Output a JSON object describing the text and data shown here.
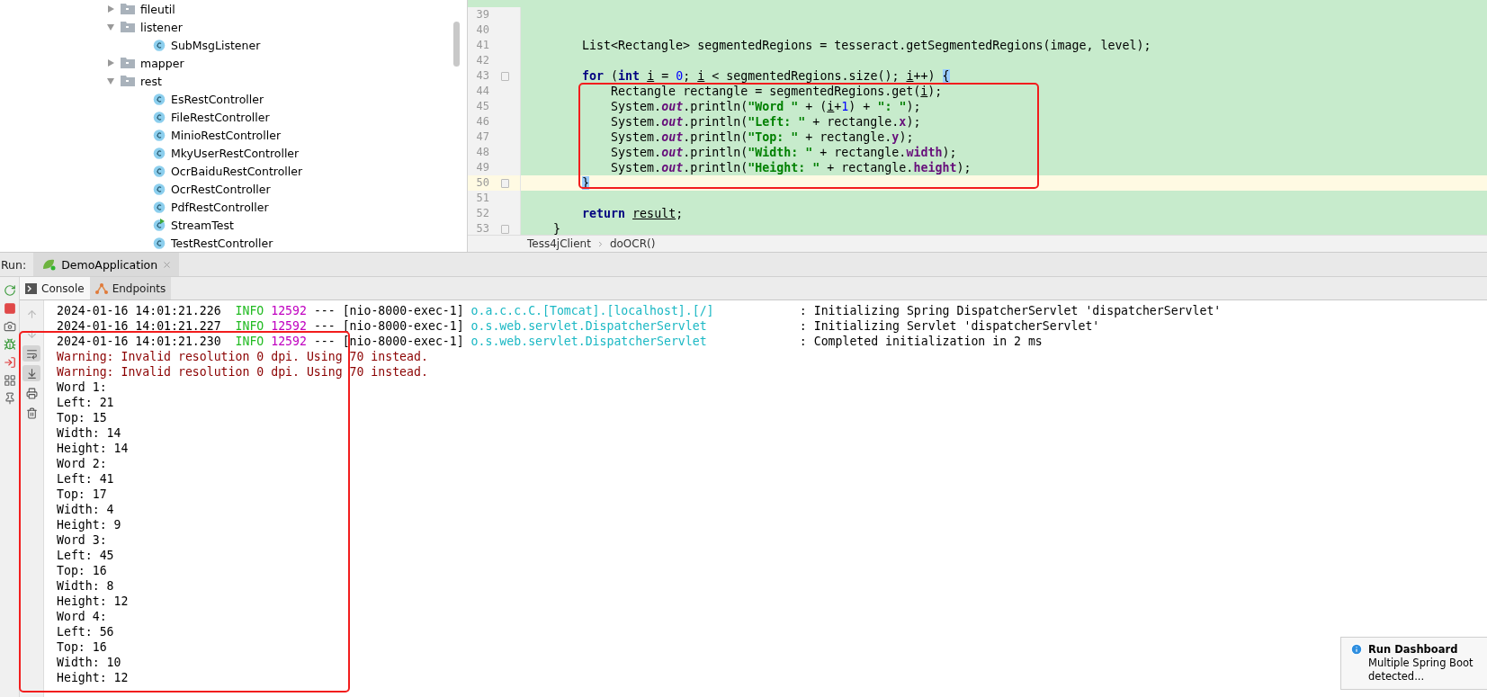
{
  "project_tree": {
    "items": [
      {
        "label": "fileutil",
        "kind": "folder",
        "expanded": false
      },
      {
        "label": "listener",
        "kind": "folder",
        "expanded": true,
        "children": [
          {
            "label": "SubMsgListener",
            "kind": "class"
          }
        ]
      },
      {
        "label": "mapper",
        "kind": "folder",
        "expanded": false
      },
      {
        "label": "rest",
        "kind": "folder",
        "expanded": true,
        "children": [
          {
            "label": "EsRestController",
            "kind": "class"
          },
          {
            "label": "FileRestController",
            "kind": "class"
          },
          {
            "label": "MinioRestController",
            "kind": "class"
          },
          {
            "label": "MkyUserRestController",
            "kind": "class"
          },
          {
            "label": "OcrBaiduRestController",
            "kind": "class"
          },
          {
            "label": "OcrRestController",
            "kind": "class"
          },
          {
            "label": "PdfRestController",
            "kind": "class"
          },
          {
            "label": "StreamTest",
            "kind": "runnable"
          },
          {
            "label": "TestRestController",
            "kind": "class"
          }
        ]
      }
    ]
  },
  "editor": {
    "lines": [
      {
        "number": "39",
        "current": false,
        "fold": false
      },
      {
        "number": "40",
        "current": false,
        "fold": false
      },
      {
        "number": "41",
        "current": false,
        "fold": false,
        "tokens": [
          {
            "kind": "plain",
            "text": "        List<Rectangle> segmentedRegions = tesseract.getSegmentedRegions(image, level);"
          }
        ]
      },
      {
        "number": "42",
        "current": false,
        "fold": false
      },
      {
        "number": "43",
        "current": false,
        "fold": true,
        "tokens": [
          {
            "kind": "kw",
            "text": "        for"
          },
          {
            "kind": "plain",
            "text": " ("
          },
          {
            "kind": "kw",
            "text": "int "
          },
          {
            "kind": "var",
            "text": "i"
          },
          {
            "kind": "plain",
            "text": " = "
          },
          {
            "kind": "num",
            "text": "0"
          },
          {
            "kind": "plain",
            "text": "; "
          },
          {
            "kind": "var",
            "text": "i"
          },
          {
            "kind": "plain",
            "text": " < segmentedRegions.size(); "
          },
          {
            "kind": "var",
            "text": "i"
          },
          {
            "kind": "plain",
            "text": "++) "
          },
          {
            "kind": "match",
            "text": "{"
          }
        ]
      },
      {
        "number": "44",
        "current": false,
        "fold": false,
        "tokens": [
          {
            "kind": "plain",
            "text": "            Rectangle rectangle = segmentedRegions.get("
          },
          {
            "kind": "var",
            "text": "i"
          },
          {
            "kind": "plain",
            "text": ");"
          }
        ]
      },
      {
        "number": "45",
        "current": false,
        "fold": false,
        "tokens": [
          {
            "kind": "plain",
            "text": "            System."
          },
          {
            "kind": "static",
            "text": "out"
          },
          {
            "kind": "plain",
            "text": ".println("
          },
          {
            "kind": "str",
            "text": "\"Word \""
          },
          {
            "kind": "plain",
            "text": " + ("
          },
          {
            "kind": "var",
            "text": "i"
          },
          {
            "kind": "plain",
            "text": "+"
          },
          {
            "kind": "num",
            "text": "1"
          },
          {
            "kind": "plain",
            "text": ") + "
          },
          {
            "kind": "str",
            "text": "\": \""
          },
          {
            "kind": "plain",
            "text": ");"
          }
        ]
      },
      {
        "number": "46",
        "current": false,
        "fold": false,
        "tokens": [
          {
            "kind": "plain",
            "text": "            System."
          },
          {
            "kind": "static",
            "text": "out"
          },
          {
            "kind": "plain",
            "text": ".println("
          },
          {
            "kind": "str",
            "text": "\"Left: \""
          },
          {
            "kind": "plain",
            "text": " + rectangle."
          },
          {
            "kind": "field",
            "text": "x"
          },
          {
            "kind": "plain",
            "text": ");"
          }
        ]
      },
      {
        "number": "47",
        "current": false,
        "fold": false,
        "tokens": [
          {
            "kind": "plain",
            "text": "            System."
          },
          {
            "kind": "static",
            "text": "out"
          },
          {
            "kind": "plain",
            "text": ".println("
          },
          {
            "kind": "str",
            "text": "\"Top: \""
          },
          {
            "kind": "plain",
            "text": " + rectangle."
          },
          {
            "kind": "field",
            "text": "y"
          },
          {
            "kind": "plain",
            "text": ");"
          }
        ]
      },
      {
        "number": "48",
        "current": false,
        "fold": false,
        "tokens": [
          {
            "kind": "plain",
            "text": "            System."
          },
          {
            "kind": "static",
            "text": "out"
          },
          {
            "kind": "plain",
            "text": ".println("
          },
          {
            "kind": "str",
            "text": "\"Width: \""
          },
          {
            "kind": "plain",
            "text": " + rectangle."
          },
          {
            "kind": "field",
            "text": "width"
          },
          {
            "kind": "plain",
            "text": ");"
          }
        ]
      },
      {
        "number": "49",
        "current": false,
        "fold": false,
        "tokens": [
          {
            "kind": "plain",
            "text": "            System."
          },
          {
            "kind": "static",
            "text": "out"
          },
          {
            "kind": "plain",
            "text": ".println("
          },
          {
            "kind": "str",
            "text": "\"Height: \""
          },
          {
            "kind": "plain",
            "text": " + rectangle."
          },
          {
            "kind": "field",
            "text": "height"
          },
          {
            "kind": "plain",
            "text": ");"
          }
        ]
      },
      {
        "number": "50",
        "current": true,
        "fold": true,
        "tokens": [
          {
            "kind": "match",
            "text": "        }"
          }
        ]
      },
      {
        "number": "51",
        "current": false,
        "fold": false
      },
      {
        "number": "52",
        "current": false,
        "fold": false,
        "tokens": [
          {
            "kind": "kw",
            "text": "        return "
          },
          {
            "kind": "var",
            "text": "result"
          },
          {
            "kind": "plain",
            "text": ";"
          }
        ]
      },
      {
        "number": "53",
        "current": false,
        "fold": true,
        "tokens": [
          {
            "kind": "plain",
            "text": "    }"
          }
        ]
      }
    ],
    "breadcrumb": [
      "Tess4jClient",
      "doOCR()"
    ]
  },
  "run_panel": {
    "label": "Run:",
    "tabs": [
      {
        "label": "DemoApplication",
        "selected": true
      }
    ],
    "side_tools": [
      {
        "kind": "rerun"
      },
      {
        "kind": "stop"
      },
      {
        "kind": "camera"
      },
      {
        "kind": "debug"
      },
      {
        "kind": "exit"
      },
      {
        "kind": "layout"
      },
      {
        "kind": "pin"
      }
    ],
    "console_tabs": [
      {
        "label": "Console",
        "kind": "console",
        "selected": true
      },
      {
        "label": "Endpoints",
        "kind": "endpoints",
        "selected": false
      }
    ],
    "console_tools": [
      {
        "kind": "up",
        "on": false,
        "disabled": true
      },
      {
        "kind": "down",
        "on": false,
        "disabled": true
      },
      {
        "kind": "wrap",
        "on": true,
        "disabled": false
      },
      {
        "kind": "scroll_end",
        "on": true,
        "disabled": false
      },
      {
        "kind": "print",
        "on": false,
        "disabled": false
      },
      {
        "kind": "clear",
        "on": false,
        "disabled": false
      }
    ],
    "output": [
      {
        "kind": "log",
        "time": "2024-01-16 14:01:21.226",
        "level": "INFO",
        "pid": "12592",
        "sep": "---",
        "thread": "[nio-8000-exec-1]",
        "logger": "o.a.c.c.C.[Tomcat].[localhost].[/]",
        "message": ": Initializing Spring DispatcherServlet 'dispatcherServlet'"
      },
      {
        "kind": "log",
        "time": "2024-01-16 14:01:21.227",
        "level": "INFO",
        "pid": "12592",
        "sep": "---",
        "thread": "[nio-8000-exec-1]",
        "logger": "o.s.web.servlet.DispatcherServlet",
        "message": ": Initializing Servlet 'dispatcherServlet'"
      },
      {
        "kind": "log",
        "time": "2024-01-16 14:01:21.230",
        "level": "INFO",
        "pid": "12592",
        "sep": "---",
        "thread": "[nio-8000-exec-1]",
        "logger": "o.s.web.servlet.DispatcherServlet",
        "message": ": Completed initialization in 2 ms"
      },
      {
        "kind": "warning",
        "text": "Warning: Invalid resolution 0 dpi. Using 70 instead."
      },
      {
        "kind": "warning",
        "text": "Warning: Invalid resolution 0 dpi. Using 70 instead."
      },
      {
        "kind": "plain",
        "text": "Word 1:"
      },
      {
        "kind": "plain",
        "text": "Left: 21"
      },
      {
        "kind": "plain",
        "text": "Top: 15"
      },
      {
        "kind": "plain",
        "text": "Width: 14"
      },
      {
        "kind": "plain",
        "text": "Height: 14"
      },
      {
        "kind": "plain",
        "text": "Word 2:"
      },
      {
        "kind": "plain",
        "text": "Left: 41"
      },
      {
        "kind": "plain",
        "text": "Top: 17"
      },
      {
        "kind": "plain",
        "text": "Width: 4"
      },
      {
        "kind": "plain",
        "text": "Height: 9"
      },
      {
        "kind": "plain",
        "text": "Word 3:"
      },
      {
        "kind": "plain",
        "text": "Left: 45"
      },
      {
        "kind": "plain",
        "text": "Top: 16"
      },
      {
        "kind": "plain",
        "text": "Width: 8"
      },
      {
        "kind": "plain",
        "text": "Height: 12"
      },
      {
        "kind": "plain",
        "text": "Word 4:"
      },
      {
        "kind": "plain",
        "text": "Left: 56"
      },
      {
        "kind": "plain",
        "text": "Top: 16"
      },
      {
        "kind": "plain",
        "text": "Width: 10"
      },
      {
        "kind": "plain",
        "text": "Height: 12"
      }
    ]
  },
  "notification": {
    "title": "Run Dashboard",
    "lines": [
      "Multiple Spring Boot",
      "detected..."
    ]
  }
}
